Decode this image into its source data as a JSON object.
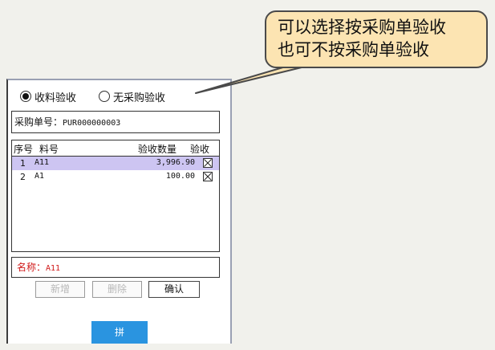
{
  "callout": {
    "lines": [
      "可以选择按采购单验收",
      "也可不按采购单验收"
    ]
  },
  "receipt_mode": {
    "options": [
      {
        "label": "收料验收",
        "selected": true
      },
      {
        "label": "无采购验收",
        "selected": false
      }
    ]
  },
  "po": {
    "label": "采购单号：",
    "value": "PUR000000003"
  },
  "table": {
    "headers": [
      "序号",
      "料号",
      "验收数量",
      "验收"
    ],
    "rows": [
      {
        "no": "1",
        "item": "A11",
        "qty": "3,996.90",
        "checked": true,
        "selected": true
      },
      {
        "no": "2",
        "item": "A1",
        "qty": "100.00",
        "checked": true,
        "selected": false
      }
    ]
  },
  "name": {
    "label": "名称：",
    "value": "A11"
  },
  "buttons": {
    "add": "新增",
    "delete": "删除",
    "confirm": "确认",
    "bottom": "拼"
  },
  "colors": {
    "callout_bg": "#fce4b2",
    "selected_row": "#cdc5f2",
    "name_text": "#d01818",
    "bottom_button": "#2a94e0"
  }
}
